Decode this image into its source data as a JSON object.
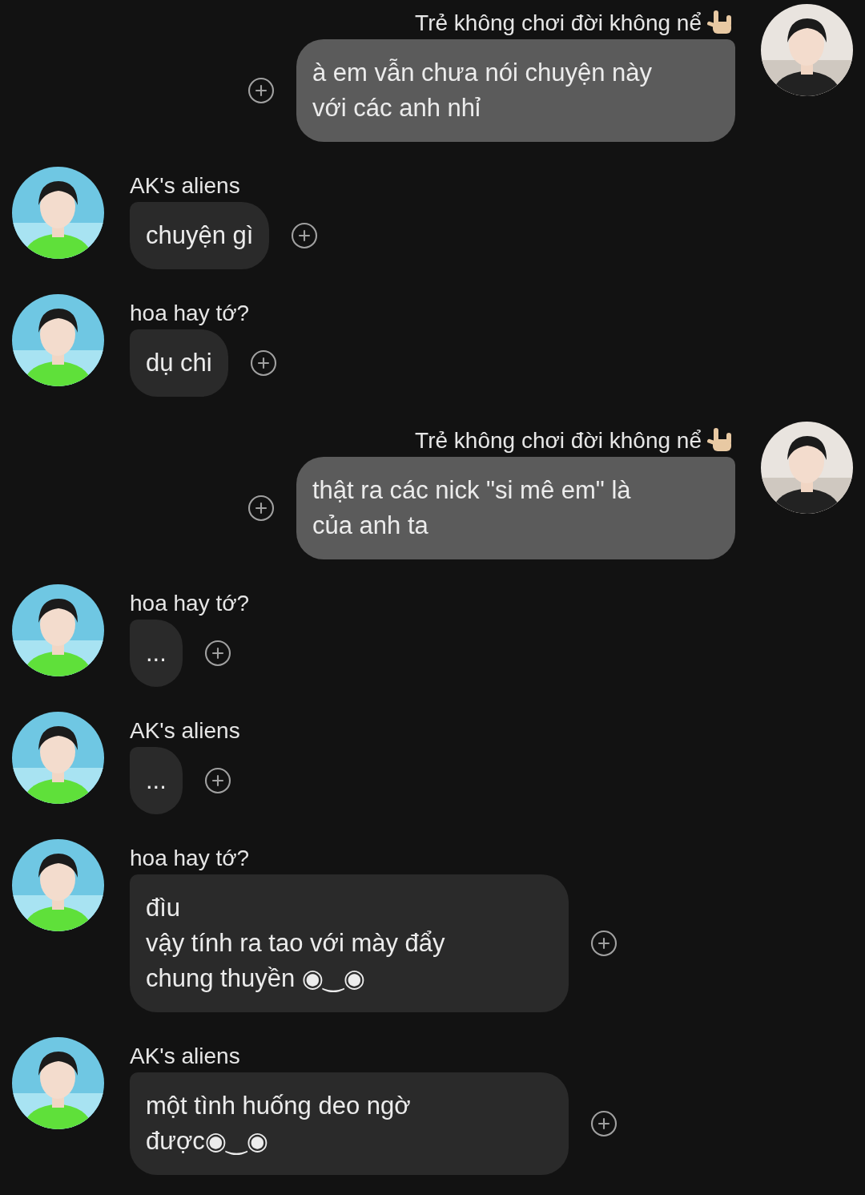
{
  "messages": [
    {
      "kind": "sent",
      "sender": "Trẻ không chơi đời không nể",
      "text": "à em vẫn chưa nói chuyện này\nvới các anh nhỉ"
    },
    {
      "kind": "received",
      "sender": "AK's aliens",
      "text": "chuyện gì"
    },
    {
      "kind": "received",
      "sender": "hoa hay tớ?",
      "text": "dụ chi"
    },
    {
      "kind": "sent",
      "sender": "Trẻ không chơi đời không nể",
      "text": "thật ra các nick \"si mê em\" là\ncủa anh ta"
    },
    {
      "kind": "received",
      "sender": "hoa hay tớ?",
      "text": "..."
    },
    {
      "kind": "received",
      "sender": "AK's aliens",
      "text": "..."
    },
    {
      "kind": "received",
      "sender": "hoa hay tớ?",
      "text": "đìu\nvậy tính ra tao với mày đẩy\nchung thuyền ◉‿◉"
    },
    {
      "kind": "received",
      "sender": "AK's aliens",
      "text": "một tình huống deo ngờ\nđược◉‿◉"
    }
  ]
}
